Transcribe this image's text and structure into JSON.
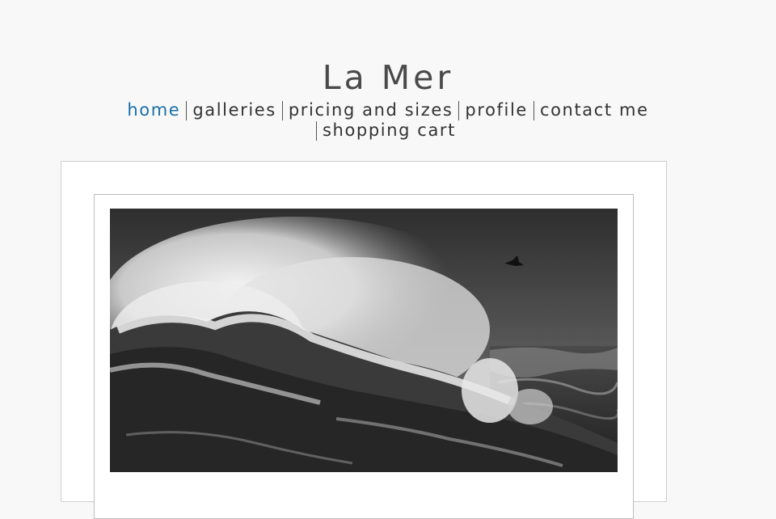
{
  "site": {
    "title": "La Mer"
  },
  "nav": {
    "items": [
      {
        "label": "home",
        "active": true
      },
      {
        "label": "galleries",
        "active": false
      },
      {
        "label": "pricing and sizes",
        "active": false
      },
      {
        "label": "profile",
        "active": false
      },
      {
        "label": "contact me",
        "active": false
      },
      {
        "label": "shopping cart",
        "active": false
      }
    ]
  },
  "colors": {
    "background": "#f8f8f8",
    "active_link": "#1a6fa8",
    "text": "#333333"
  },
  "photo": {
    "subject": "black and white crashing ocean wave with a seabird"
  }
}
